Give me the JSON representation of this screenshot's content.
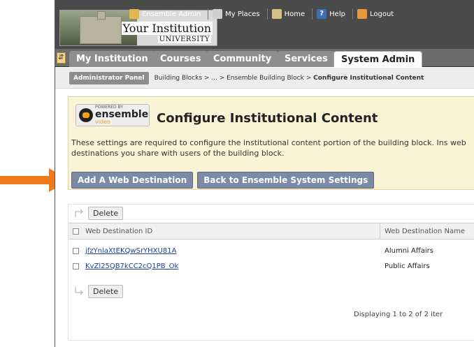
{
  "top_nav": {
    "items": [
      {
        "label": "Ensemble Admin",
        "icon": "user-icon"
      },
      {
        "label": "My Places",
        "icon": "places-icon"
      },
      {
        "label": "Home",
        "icon": "home-icon"
      },
      {
        "label": "Help",
        "icon": "help-icon"
      },
      {
        "label": "Logout",
        "icon": "logout-icon"
      }
    ]
  },
  "banner": {
    "title": "Your Institution",
    "subtitle": "UNIVERSITY"
  },
  "tabs": [
    {
      "label": "My Institution"
    },
    {
      "label": "Courses"
    },
    {
      "label": "Community"
    },
    {
      "label": "Services"
    },
    {
      "label": "System Admin",
      "active": true
    }
  ],
  "breadcrumb": {
    "admin_panel": "Administrator Panel",
    "path": "Building Blocks  >  ...  >  Ensemble Building Block  >",
    "current": "Configure Institutional Content"
  },
  "logo": {
    "powered_by": "POWERED BY",
    "name": "ensemble",
    "sub": "video"
  },
  "page": {
    "title": "Configure Institutional Content",
    "description": "These settings are required to configure the institutional content portion of the building block. Ins web destinations you share with users of the building block."
  },
  "buttons": {
    "add_web_destination": "Add A Web Destination",
    "back": "Back to Ensemble System Settings"
  },
  "table": {
    "delete_label": "Delete",
    "columns": [
      "Web Destination ID",
      "Web Destination Name"
    ],
    "rows": [
      {
        "id": "jfzYnlaXtEKQwSrYHXU81A",
        "name": "Alumni Affairs"
      },
      {
        "id": "KvZl25QB7kCC2cQ1PB_Ok",
        "name": "Public Affairs"
      }
    ],
    "footer": "Displaying 1 to 2 of 2 iter"
  },
  "colors": {
    "arrow": "#f07a1a",
    "tab_active_bg": "#ffffff",
    "button_bg": "#7b8aa5",
    "link": "#1a3e9a"
  }
}
